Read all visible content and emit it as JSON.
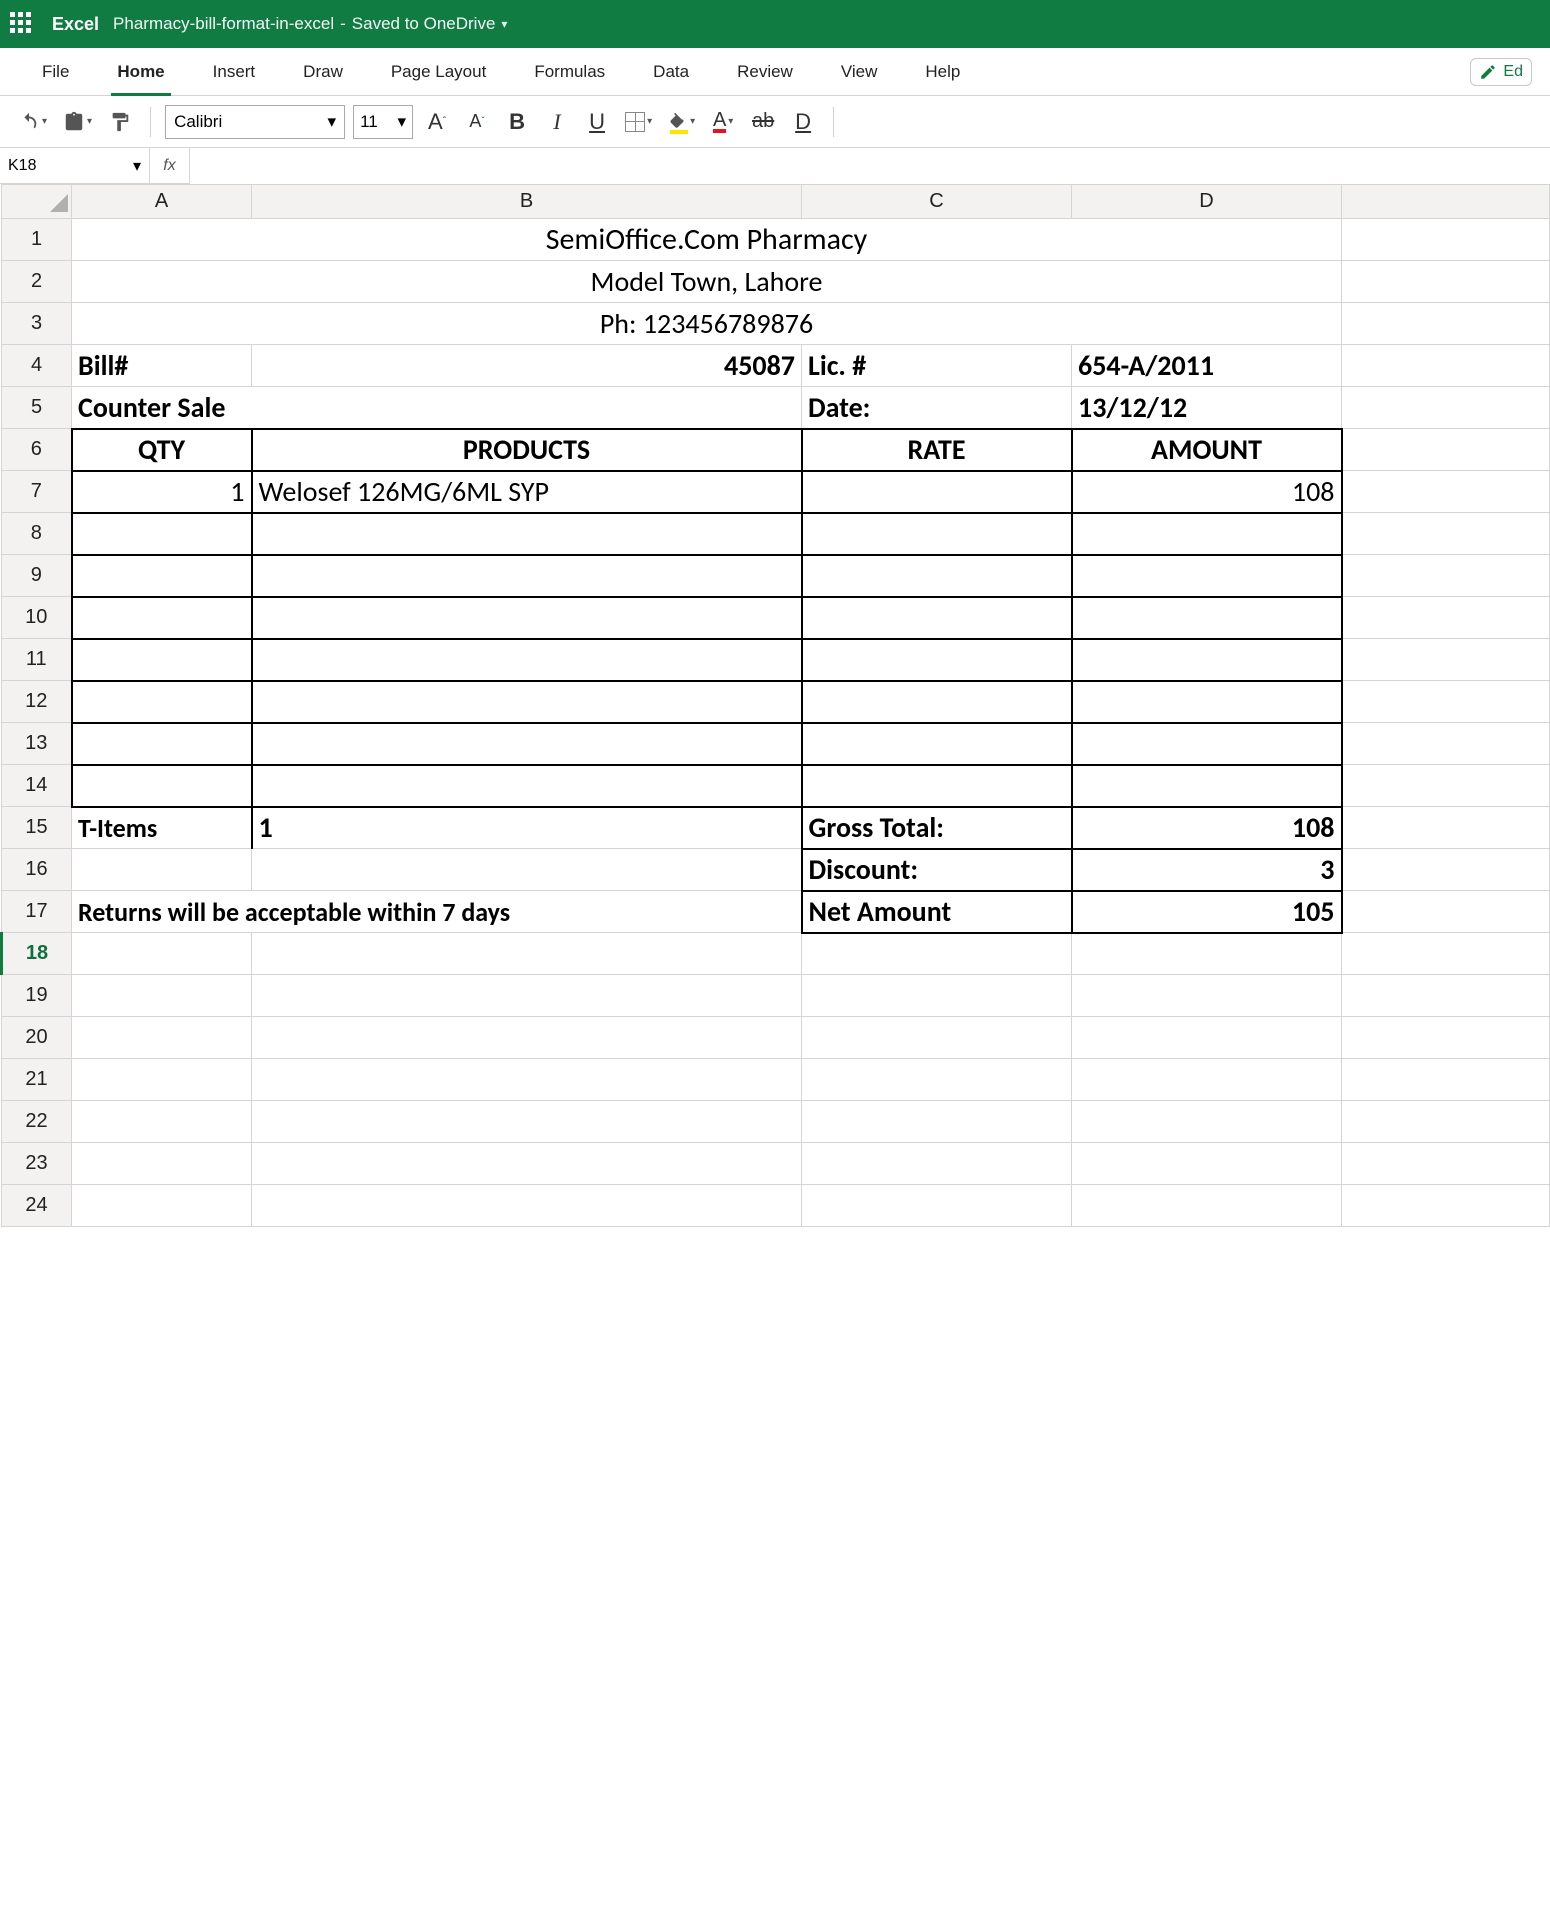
{
  "title_bar": {
    "app_name": "Excel",
    "doc_name": "Pharmacy-bill-format-in-excel",
    "save_status": "Saved to OneDrive"
  },
  "tabs": {
    "file": "File",
    "home": "Home",
    "insert": "Insert",
    "draw": "Draw",
    "page_layout": "Page Layout",
    "formulas": "Formulas",
    "data": "Data",
    "review": "Review",
    "view": "View",
    "help": "Help",
    "editing_hint": "Ed"
  },
  "toolbar": {
    "font_name": "Calibri",
    "font_size": "11",
    "grow_font": "A",
    "shrink_font": "A",
    "bold": "B",
    "italic": "I",
    "underline": "U",
    "strike": "ab",
    "underline2": "D"
  },
  "namebox": {
    "cell_ref": "K18",
    "fx": "fx",
    "formula_value": ""
  },
  "columns": {
    "A": "A",
    "B": "B",
    "C": "C",
    "D": "D"
  },
  "rows": [
    "1",
    "2",
    "3",
    "4",
    "5",
    "6",
    "7",
    "8",
    "9",
    "10",
    "11",
    "12",
    "13",
    "14",
    "15",
    "16",
    "17",
    "18",
    "19",
    "20",
    "21",
    "22",
    "23",
    "24"
  ],
  "sheet": {
    "r1_title": "SemiOffice.Com Pharmacy",
    "r2_addr": "Model Town, Lahore",
    "r3_phone": "Ph: 123456789876",
    "r4": {
      "billLabel": "Bill#",
      "billNo": "45087",
      "licLabel": "Lic. #",
      "licNo": "654-A/2011"
    },
    "r5": {
      "counter": "Counter Sale",
      "dateLabel": "Date:",
      "date": "13/12/12"
    },
    "hdr": {
      "qty": "QTY",
      "products": "PRODUCTS",
      "rate": "RATE",
      "amount": "AMOUNT"
    },
    "item1": {
      "qty": "1",
      "product": "Welosef 126MG/6ML SYP",
      "rate": "",
      "amount": "108"
    },
    "r15": {
      "titemsLabel": "T-Items",
      "titems": "1",
      "gross": "Gross Total:",
      "grossVal": "108"
    },
    "r16": {
      "disc": "Discount:",
      "discVal": "3"
    },
    "r17": {
      "note": "Returns will be acceptable within 7 days",
      "net": "Net Amount",
      "netVal": "105"
    }
  }
}
